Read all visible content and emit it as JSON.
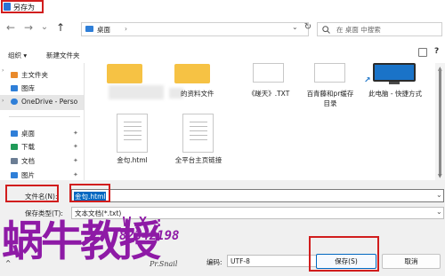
{
  "window": {
    "title": "另存为"
  },
  "nav": {
    "back": "←",
    "forward": "→",
    "dropdown": "⌄",
    "up": "↑",
    "refresh": "↻"
  },
  "address": {
    "path_item": "桌面",
    "chevron": "›"
  },
  "search": {
    "placeholder": "在 桌面 中搜索"
  },
  "toolbar": {
    "organize": "组织 ▾",
    "new_folder": "新建文件夹"
  },
  "sidebar": {
    "items": [
      {
        "label": "主文件夹",
        "icon": "home-icon",
        "color": "#e98a2b",
        "pinned": false
      },
      {
        "label": "图库",
        "icon": "gallery-icon",
        "color": "#2f7fd8",
        "pinned": false
      },
      {
        "label": "OneDrive - Perso",
        "icon": "cloud-icon",
        "color": "#2f7fd8",
        "pinned": false
      },
      {
        "label": "桌面",
        "icon": "desktop-icon",
        "color": "#2f7fd8",
        "pinned": true
      },
      {
        "label": "下载",
        "icon": "download-icon",
        "color": "#1f9a58",
        "pinned": true
      },
      {
        "label": "文档",
        "icon": "documents-icon",
        "color": "#6b7d94",
        "pinned": true
      },
      {
        "label": "图片",
        "icon": "pictures-icon",
        "color": "#2f7fd8",
        "pinned": true
      }
    ],
    "pin_glyph": "✦"
  },
  "files": {
    "row1": [
      {
        "label": "",
        "type": "folder"
      },
      {
        "label": "的资料文件",
        "type": "folder"
      },
      {
        "label": "《蹉天》.TXT",
        "type": "document"
      },
      {
        "label": "百青藤和pr缓存目录",
        "type": "document"
      },
      {
        "label": "此电脑 - 快捷方式",
        "type": "computer"
      }
    ],
    "row2": [
      {
        "label": "金句.html",
        "type": "document"
      },
      {
        "label": "全平台主页链接",
        "type": "document"
      }
    ]
  },
  "form": {
    "filename_label": "文件名(N):",
    "filename_value": "金句.html",
    "filetype_label": "保存类型(T):",
    "filetype_value": "文本文档(*.txt)",
    "encoding_label": "编码:",
    "encoding_value": "UTF-8",
    "hide_folders": "^"
  },
  "buttons": {
    "save": "保存(S)",
    "cancel": "取消"
  },
  "watermark": {
    "main": "蜗牛教授",
    "wx_label": "W X :",
    "wx_number": "82342198",
    "signature": "Pr.Snail"
  },
  "colors": {
    "accent": "#0067c0",
    "highlight": "#d11d1d",
    "folder": "#f6c244",
    "watermark": "#8e1aa6"
  }
}
